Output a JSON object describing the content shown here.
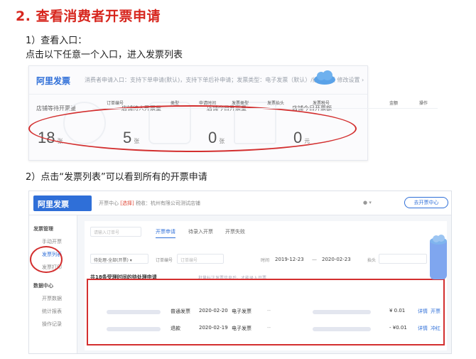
{
  "heading": "2. 查看消费者开票申请",
  "step1": {
    "line1": "1）查看入口：",
    "line2": "点击以下任意一个入口，进入发票列表"
  },
  "step2": "2）点击“发票列表”可以看到所有的开票申请",
  "panel1": {
    "brand": "阿里发票",
    "info": "消费者申请入口：支持下单申请(默认)，支持下单后补申请；发票类型：电子发票（默认）/纸质发票  修改设置 ›",
    "stats": [
      {
        "label": "店铺等待开票量",
        "value": "18",
        "unit": "张"
      },
      {
        "label": "店铺待人开票量",
        "value": "5",
        "unit": "张"
      },
      {
        "label": "店铺今日开票量",
        "value": "0",
        "unit": "张"
      },
      {
        "label": "店铺今日开票额",
        "value": "0",
        "unit": "元"
      }
    ]
  },
  "panel2": {
    "brand": "阿里发票",
    "crumb_prefix": "开票中心",
    "crumb_tag": "[选择]",
    "crumb_text": "税收：杭州有限公司测试店铺",
    "ticket_button": "去开票中心",
    "sidebar": [
      {
        "label": "发票管理",
        "type": "group"
      },
      {
        "label": "手动开票",
        "type": "item"
      },
      {
        "label": "发票列表",
        "type": "item",
        "active": true
      },
      {
        "label": "发票打印",
        "type": "item"
      },
      {
        "label": "数据中心",
        "type": "group"
      },
      {
        "label": "开票数据",
        "type": "item"
      },
      {
        "label": "统计报表",
        "type": "item"
      },
      {
        "label": "操作记录",
        "type": "item"
      }
    ],
    "search_placeholder": "请输入订单号",
    "tabs": [
      "开票申请",
      "待录入开票",
      "开票失败"
    ],
    "filters": {
      "status": "待处理-全部(开票)",
      "order_label": "订单编号",
      "order_placeholder": "订单编号",
      "time_label": "时间",
      "date_start": "2019-12-23",
      "date_sep": "—",
      "date_end": "2020-02-23",
      "buyer_label": "抬头"
    },
    "summary": "共18条受理时间的待处理申请",
    "summary_note": "批量标注发票信息后，才能录入开票",
    "columns": [
      "订单编号",
      "类型",
      "申请时间",
      "发票类型",
      "发票抬头",
      "发票税号",
      "金额",
      "操作"
    ],
    "rows": [
      {
        "type": "普通发票",
        "time": "2020-02-20",
        "invoice_type": "电子发票",
        "title": "--",
        "amount": "¥ 0.01",
        "ops": [
          "详情",
          "开票"
        ]
      },
      {
        "type": "退款",
        "time": "2020-02-19",
        "invoice_type": "电子发票",
        "title": "--",
        "amount": "- ¥0.01",
        "ops": [
          "详情",
          "冲红"
        ]
      }
    ]
  },
  "colors": {
    "accent": "#2f6fd8",
    "highlight": "#d32f2f",
    "heading": "#d7261e"
  }
}
